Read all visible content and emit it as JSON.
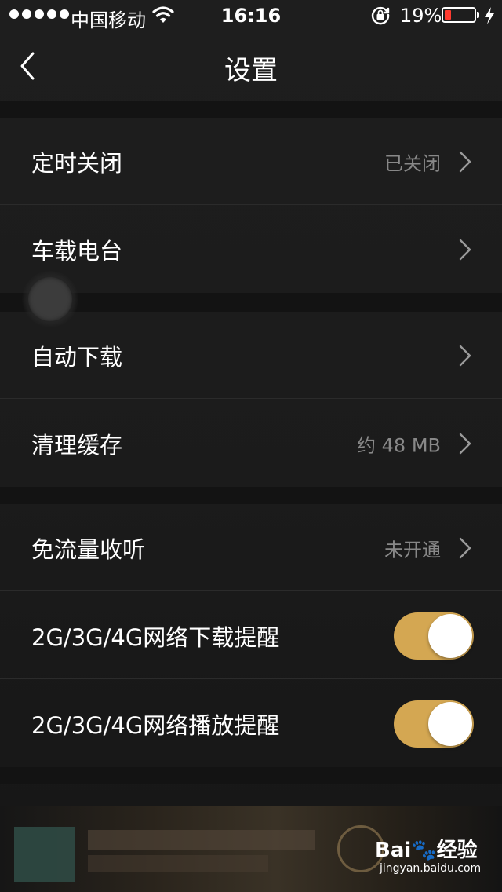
{
  "status_bar": {
    "carrier": "中国移动",
    "time": "16:16",
    "battery_percent": "19%",
    "battery_level": 0.19,
    "battery_color": "#ff3b30"
  },
  "nav": {
    "title": "设置",
    "back_icon": "chevron-left-icon"
  },
  "groups": [
    {
      "items": [
        {
          "label": "定时关闭",
          "value": "已关闭",
          "type": "disclosure"
        },
        {
          "label": "车载电台",
          "value": "",
          "type": "disclosure"
        }
      ]
    },
    {
      "items": [
        {
          "label": "自动下载",
          "value": "",
          "type": "disclosure"
        },
        {
          "label": "清理缓存",
          "value": "约 48 MB",
          "type": "disclosure"
        }
      ]
    },
    {
      "items": [
        {
          "label": "免流量收听",
          "value": "未开通",
          "type": "disclosure"
        },
        {
          "label": "2G/3G/4G网络下载提醒",
          "type": "toggle",
          "on": true
        },
        {
          "label": "2G/3G/4G网络播放提醒",
          "type": "toggle",
          "on": true
        }
      ]
    }
  ],
  "colors": {
    "accent_toggle": "#d4a752",
    "background": "#1c1c1c",
    "secondary_text": "#888888"
  },
  "watermark": {
    "logo": "Bai🐾经验",
    "url": "jingyan.baidu.com"
  }
}
